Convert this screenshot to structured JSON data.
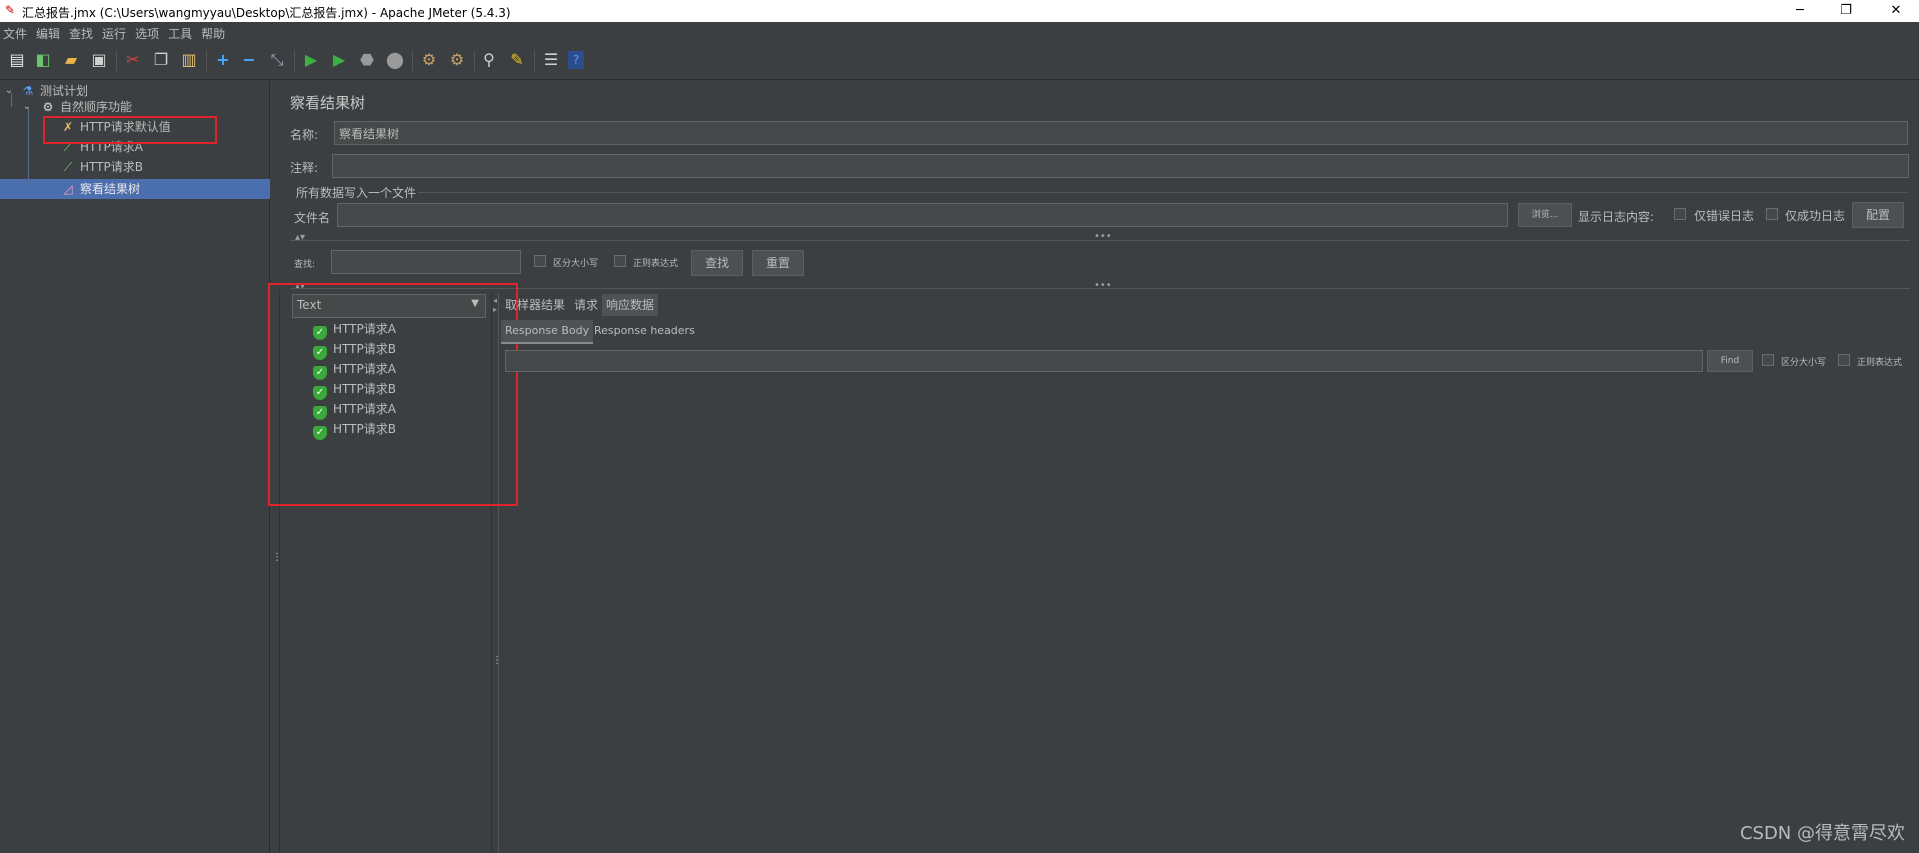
{
  "window": {
    "title": "汇总报告.jmx (C:\\Users\\wangmyyau\\Desktop\\汇总报告.jmx) - Apache JMeter (5.4.3)",
    "minimize": "─",
    "maximize": "❐",
    "close": "✕"
  },
  "menu": [
    "文件",
    "编辑",
    "查找",
    "运行",
    "选项",
    "工具",
    "帮助"
  ],
  "toolbar": {
    "icons": [
      "new-icon",
      "templates-icon",
      "open-icon",
      "save-icon",
      "cut-icon",
      "copy-icon",
      "paste-icon",
      "expand-icon",
      "collapse-icon",
      "toggle-icon",
      "start-icon",
      "start-no-pause-icon",
      "stop-icon",
      "shutdown-icon",
      "clear-icon",
      "clear-all-icon",
      "search-icon",
      "reset-search-icon",
      "function-helper-icon",
      "help-icon"
    ]
  },
  "tree": {
    "nodes": [
      {
        "label": "测试计划",
        "icon": "flask-icon"
      },
      {
        "label": "自然顺序功能",
        "icon": "gear-icon"
      },
      {
        "label": "HTTP请求默认值",
        "icon": "tools-icon"
      },
      {
        "label": "HTTP请求A",
        "icon": "pipette-icon"
      },
      {
        "label": "HTTP请求B",
        "icon": "pipette-icon"
      },
      {
        "label": "察看结果树",
        "icon": "chart-icon"
      }
    ]
  },
  "panel": {
    "title": "察看结果树",
    "name_label": "名称:",
    "name_value": "察看结果树",
    "comment_label": "注释:",
    "comment_value": "",
    "file_section": "所有数据写入一个文件",
    "filename_label": "文件名",
    "browse": "浏览...",
    "log_label": "显示日志内容:",
    "errors_only": "仅错误日志",
    "success_only": "仅成功日志",
    "configure": "配置",
    "search_label": "查找:",
    "case_sensitive": "区分大小写",
    "regex": "正则表达式",
    "search_btn": "查找",
    "reset_btn": "重置"
  },
  "results": {
    "renderer": "Text",
    "items": [
      "HTTP请求A",
      "HTTP请求B",
      "HTTP请求A",
      "HTTP请求B",
      "HTTP请求A",
      "HTTP请求B"
    ],
    "tabs": [
      "取样器结果",
      "请求",
      "响应数据"
    ],
    "subtabs": [
      "Response Body",
      "Response headers"
    ],
    "find_btn": "Find",
    "case_sensitive": "区分大小写",
    "regex": "正则表达式"
  },
  "watermark": "CSDN @得意霄尽欢"
}
